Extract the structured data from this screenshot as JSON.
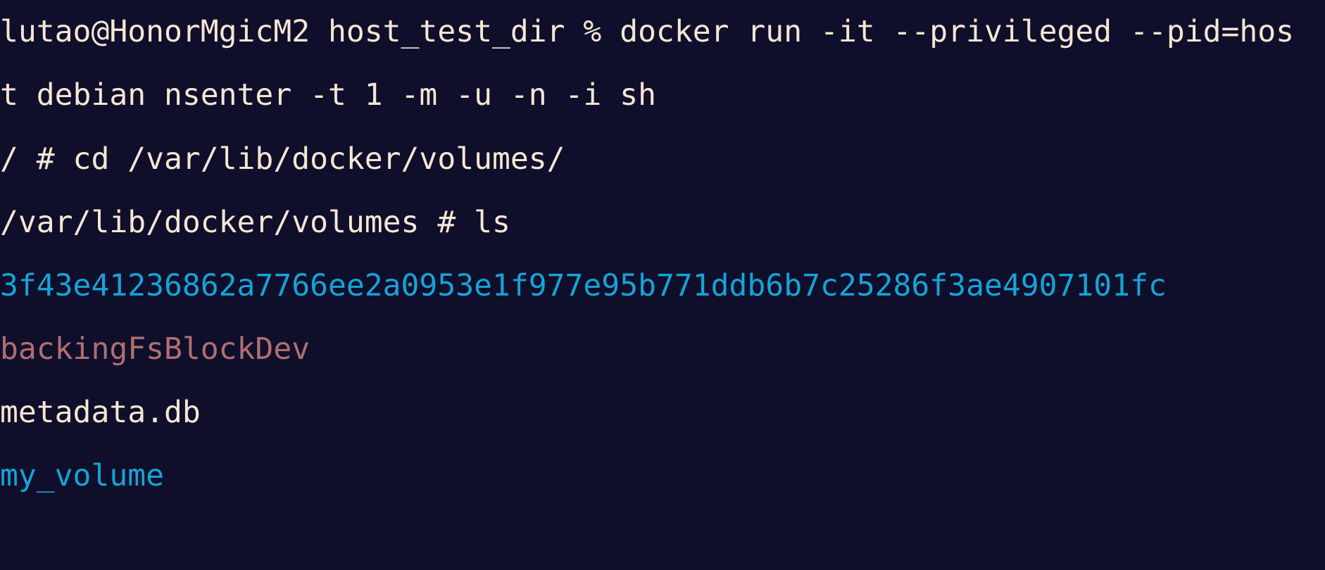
{
  "terminal": {
    "colors": {
      "background": "#0f0f2b",
      "foreground": "#f7e6d3",
      "directory": "#17a3d6",
      "special_file": "#b06f6f"
    },
    "lines": [
      "lutao@HonorMgicM2 host_test_dir % docker run -it --privileged --pid=hos",
      "t debian nsenter -t 1 -m -u -n -i sh",
      "/ # cd /var/lib/docker/volumes/",
      "/var/lib/docker/volumes # ls",
      "3f43e41236862a7766ee2a0953e1f977e95b771ddb6b7c25286f3ae4907101fc",
      "backingFsBlockDev",
      "metadata.db",
      "my_volume"
    ]
  }
}
